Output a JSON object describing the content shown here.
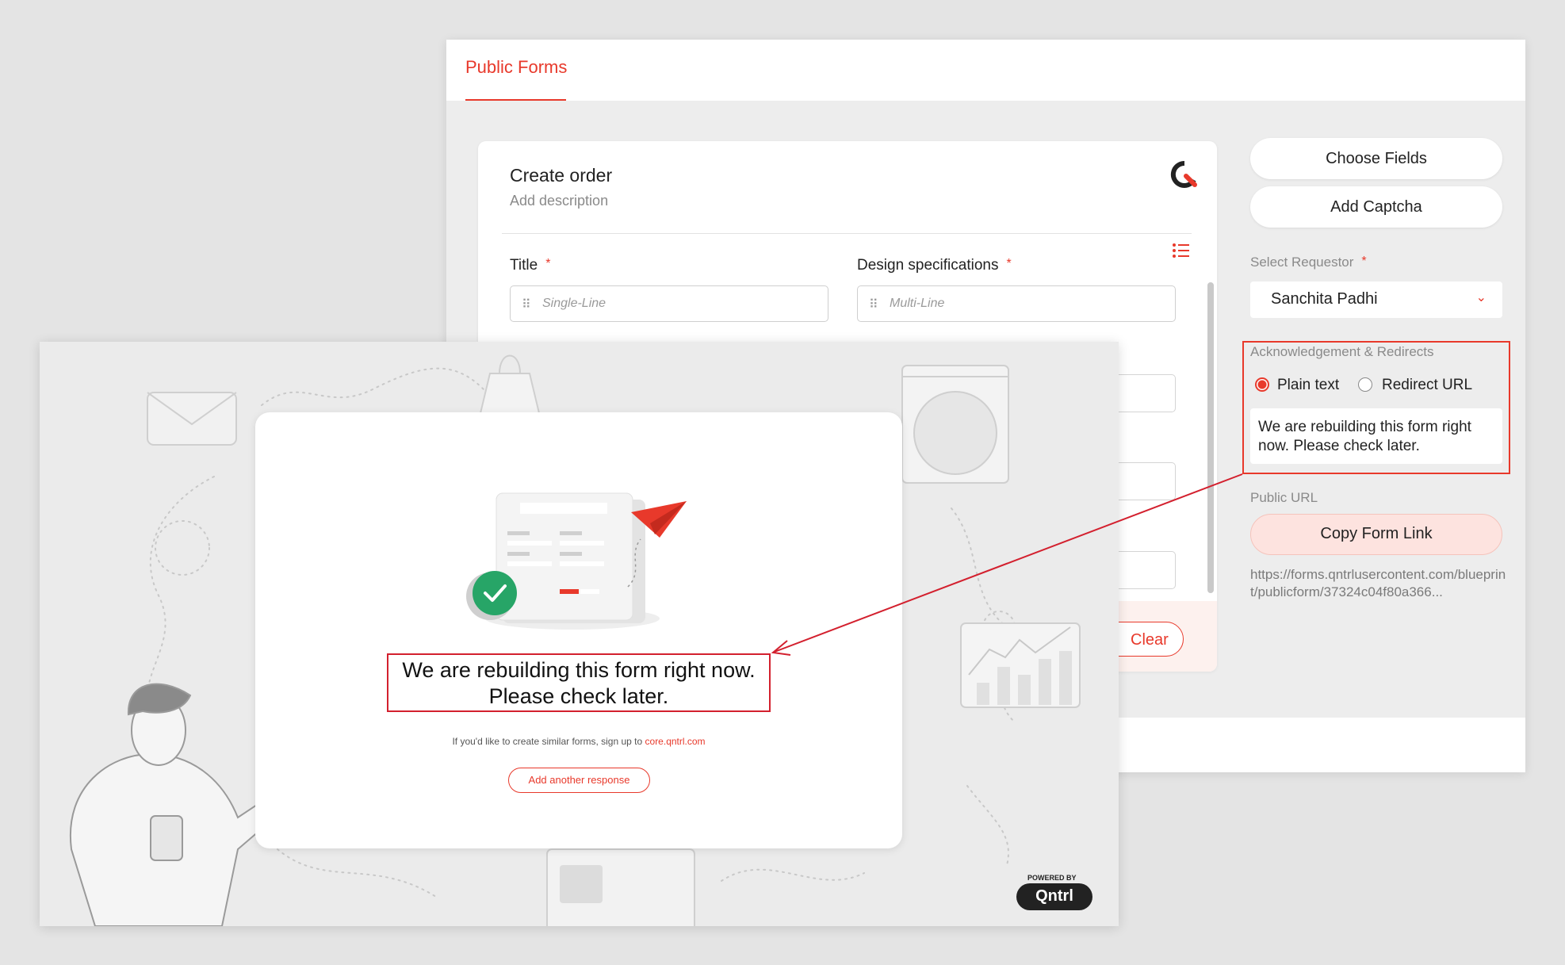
{
  "builder": {
    "tab_label": "Public Forms",
    "form": {
      "title": "Create order",
      "description": "Add description",
      "fields": [
        {
          "label": "Title",
          "required": "*",
          "placeholder": "Single-Line"
        },
        {
          "label": "Design specifications",
          "required": "*",
          "placeholder": "Multi-Line"
        }
      ],
      "clear_label": "Clear"
    },
    "panel": {
      "choose_fields_label": "Choose Fields",
      "add_captcha_label": "Add Captcha",
      "select_requestor_label": "Select Requestor",
      "select_requestor_required": "*",
      "selected_requestor": "Sanchita Padhi",
      "ack_label": "Acknowledgement & Redirects",
      "option_plain_text": "Plain text",
      "option_redirect_url": "Redirect URL",
      "selected_option": "Plain text",
      "ack_message": "We are rebuilding this form right now. Please check later.",
      "public_url_label": "Public URL",
      "copy_link_label": "Copy Form Link",
      "public_url": "https://forms.qntrlusercontent.com/blueprint/publicform/37324c04f80a366..."
    }
  },
  "preview": {
    "message_line1": "We are rebuilding this form right now.",
    "message_line2": "Please check later.",
    "signup_text": "If you'd like to create similar forms, sign up to",
    "signup_link": "core.qntrl.com",
    "add_response_label": "Add another response",
    "powered_by": "POWERED BY",
    "brand": "Qntrl"
  },
  "colors": {
    "accent": "#e8392b",
    "highlight_border": "#d3202e",
    "success": "#27a567"
  },
  "icons": [
    "qntrl-logo-icon",
    "list-settings-icon",
    "drag-grip-icon",
    "chevron-down-icon",
    "check-circle-icon",
    "paper-plane-icon",
    "envelope-icon",
    "shopping-bag-icon"
  ]
}
